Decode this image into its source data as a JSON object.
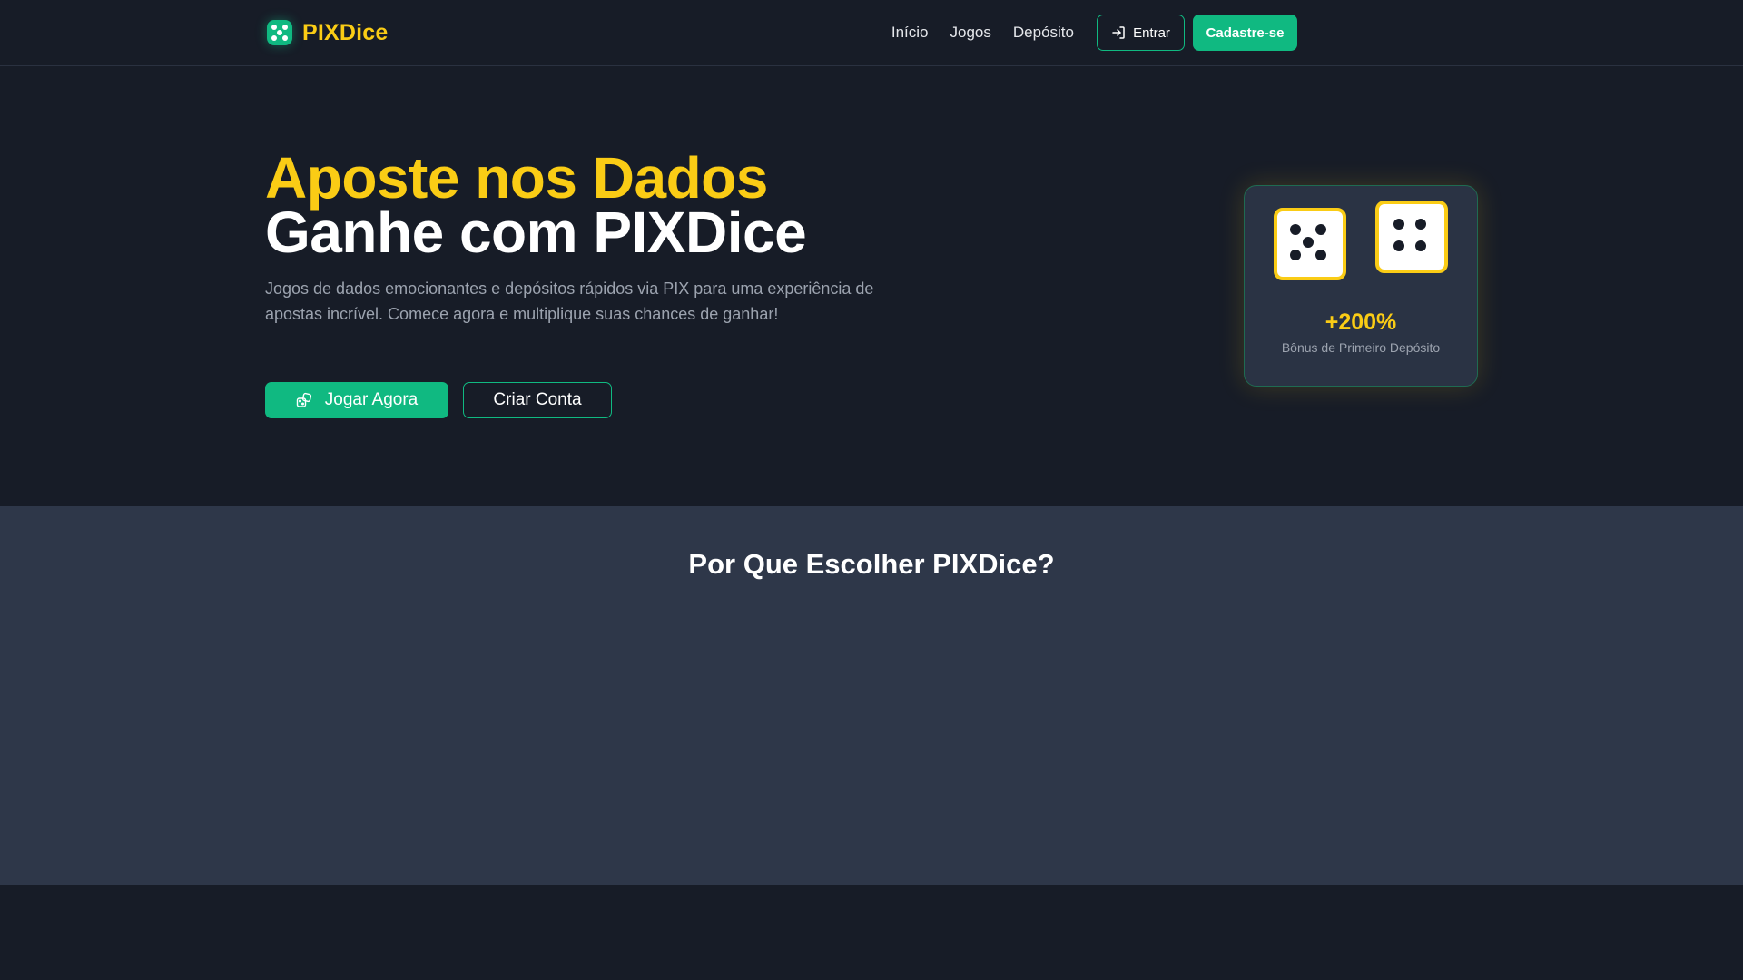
{
  "header": {
    "logo_text": "PIXDice",
    "nav": [
      "Início",
      "Jogos",
      "Depósito"
    ],
    "login_label": "Entrar",
    "signup_label": "Cadastre-se"
  },
  "hero": {
    "title_line1": "Aposte nos Dados",
    "title_line2": "Ganhe com PIXDice",
    "subtitle": "Jogos de dados emocionantes e depósitos rápidos via PIX para uma experiência de apostas incrível. Comece agora e multiplique suas chances de ganhar!",
    "play_label": "Jogar Agora",
    "create_label": "Criar Conta"
  },
  "bonus": {
    "die_one_face": 5,
    "die_two_face": 4,
    "value": "+200%",
    "label": "Bônus de Primeiro Depósito"
  },
  "features": {
    "title": "Por Que Escolher PIXDice?"
  },
  "icons": {
    "logo": "dice-icon",
    "login": "sign-in-icon",
    "play": "dice-play-icon"
  },
  "colors": {
    "background": "#171c27",
    "accent_green": "#10b981",
    "accent_yellow": "#facc15",
    "section_alt": "#2e3749",
    "card": "#2a3344",
    "muted_text": "#9ca3af"
  }
}
